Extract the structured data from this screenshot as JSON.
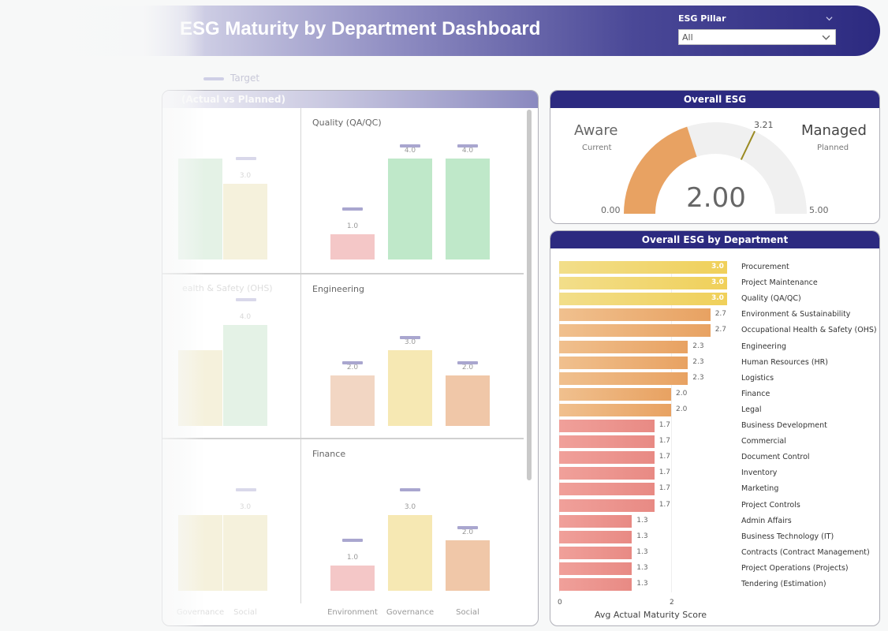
{
  "header": {
    "title": "ESG Maturity by Department Dashboard",
    "slicer_label": "ESG Pillar",
    "slicer_value": "All"
  },
  "legend": {
    "target_label": "Target"
  },
  "left_panel": {
    "title": "(Actual vs Planned)",
    "x_labels": [
      "Environment",
      "Governance",
      "Social"
    ],
    "left_x_labels": [
      "Governance",
      "Social"
    ],
    "depts": [
      {
        "name": "Quality (QA/QC)",
        "actual": [
          1.0,
          4.0,
          4.0
        ],
        "target": [
          2.0,
          4.5,
          4.5
        ],
        "labels": [
          "1.0",
          "4.0",
          "4.0"
        ]
      },
      {
        "name": "Engineering",
        "actual": [
          2.0,
          3.0,
          2.0
        ],
        "target": [
          2.5,
          3.5,
          2.5
        ],
        "labels": [
          "2.0",
          "3.0",
          "2.0"
        ]
      },
      {
        "name": "Finance",
        "actual": [
          1.0,
          3.0,
          2.0
        ],
        "target": [
          2.0,
          4.0,
          2.5
        ],
        "labels": [
          "1.0",
          "3.0",
          "2.0"
        ]
      }
    ],
    "left_depts": [
      {
        "name": "",
        "labels": [
          "",
          "3.0"
        ]
      },
      {
        "name": "Occupational Health & Safety (OHS)",
        "short": "ealth & Safety (OHS)",
        "labels": [
          "",
          "4.0"
        ]
      },
      {
        "name": "",
        "labels": [
          "",
          "3.0"
        ]
      }
    ]
  },
  "gauge": {
    "title": "Overall ESG",
    "current_word": "Aware",
    "current_label": "Current",
    "planned_word": "Managed",
    "planned_label": "Planned",
    "min": "0.00",
    "max": "5.00",
    "value": 2.0,
    "value_label": "2.00",
    "target": 3.21,
    "target_label": "3.21",
    "colors": {
      "fill": "#e8a262",
      "track": "#f0f0f0",
      "target": "#9a8a22"
    }
  },
  "dept_chart": {
    "title": "Overall ESG by Department",
    "axis_title": "Avg Actual Maturity Score",
    "ticks": [
      "0",
      "2"
    ],
    "chart_data": {
      "type": "bar",
      "categories": [
        "Procurement",
        "Project Maintenance",
        "Quality (QA/QC)",
        "Environment & Sustainability",
        "Occupational Health & Safety (OHS)",
        "Engineering",
        "Human Resources (HR)",
        "Logistics",
        "Finance",
        "Legal",
        "Business Development",
        "Commercial",
        "Document Control",
        "Inventory",
        "Marketing",
        "Project Controls",
        "Admin Affairs",
        "Business Technology (IT)",
        "Contracts (Contract Management)",
        "Project Operations (Projects)",
        "Tendering (Estimation)"
      ],
      "values": [
        3.0,
        3.0,
        3.0,
        2.7,
        2.7,
        2.3,
        2.3,
        2.3,
        2.0,
        2.0,
        1.7,
        1.7,
        1.7,
        1.7,
        1.7,
        1.7,
        1.3,
        1.3,
        1.3,
        1.3,
        1.3
      ],
      "value_labels": [
        "3.0",
        "3.0",
        "3.0",
        "2.7",
        "2.7",
        "2.3",
        "2.3",
        "2.3",
        "2.0",
        "2.0",
        "1.7",
        "1.7",
        "1.7",
        "1.7",
        "1.7",
        "1.7",
        "1.3",
        "1.3",
        "1.3",
        "1.3",
        "1.3"
      ],
      "xlabel": "Avg Actual Maturity Score",
      "xlim": [
        0,
        3
      ]
    }
  }
}
